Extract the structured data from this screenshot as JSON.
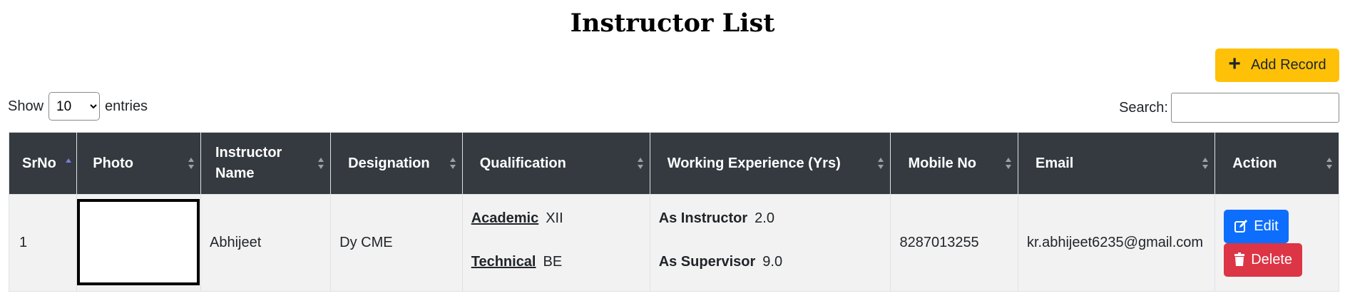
{
  "page": {
    "title": "Instructor List"
  },
  "toolbar": {
    "add_label": "Add Record"
  },
  "length_menu": {
    "show": "Show",
    "selected": "10",
    "entries": "entries"
  },
  "search": {
    "label": "Search:",
    "value": ""
  },
  "table": {
    "columns": [
      "SrNo",
      "Photo",
      "Instructor Name",
      "Designation",
      "Qualification",
      "Working Experience (Yrs)",
      "Mobile No",
      "Email",
      "Action"
    ],
    "rows": [
      {
        "srno": "1",
        "name": "Abhijeet",
        "designation": "Dy CME",
        "qualification": {
          "academic_label": "Academic",
          "academic_value": "XII",
          "technical_label": "Technical",
          "technical_value": "BE"
        },
        "experience": {
          "instructor_label": "As Instructor",
          "instructor_value": "2.0",
          "supervisor_label": "As Supervisor",
          "supervisor_value": "9.0"
        },
        "mobile": "8287013255",
        "email": "kr.abhijeet6235@gmail.com",
        "edit_label": "Edit",
        "delete_label": "Delete"
      }
    ]
  },
  "colors": {
    "header_bg": "#343a40",
    "add_btn": "#ffc107",
    "edit_btn": "#0d6efd",
    "delete_btn": "#dc3545",
    "row_bg": "#f2f2f2"
  }
}
